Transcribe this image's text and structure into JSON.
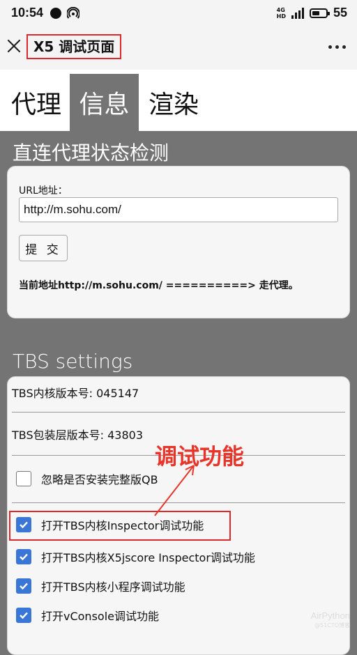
{
  "status_bar": {
    "time": "10:54",
    "network": "4G\nHD",
    "battery": "55",
    "battery_level": 0.55
  },
  "titlebar": {
    "title": "X5 调试页面",
    "close_icon": "close-icon",
    "more_icon": "more-icon"
  },
  "tabs": [
    {
      "label": "代理",
      "active": false
    },
    {
      "label": "信息",
      "active": true
    },
    {
      "label": "渲染",
      "active": false
    }
  ],
  "proxy": {
    "section_title": "直连代理状态检测",
    "url_label": "URL地址：",
    "url_value": "http://m.sohu.com/",
    "submit_label": "提 交",
    "status_text": "当前地址http://m.sohu.com/ ==========> 走代理。"
  },
  "tbs": {
    "section_title": "TBS settings",
    "kernel_version": "TBS内核版本号: 045147",
    "wrapper_version": "TBS包装层版本号: 43803",
    "options": [
      {
        "label": "忽略是否安装完整版QB",
        "checked": false
      },
      {
        "label": "打开TBS内核Inspector调试功能",
        "checked": true
      },
      {
        "label": "打开TBS内核X5jscore Inspector调试功能",
        "checked": true
      },
      {
        "label": "打开TBS内核小程序调试功能",
        "checked": true
      },
      {
        "label": "打开vConsole调试功能",
        "checked": true
      }
    ]
  },
  "annotation": {
    "label": "调试功能",
    "color": "#e8352a"
  },
  "watermark": {
    "name": "AirPython",
    "credit": "@51CTO博客"
  },
  "colors": {
    "panel_bg": "#747474",
    "active_tab_bg": "#747474",
    "checkbox_on": "#3a76d6",
    "highlight": "#e0282a"
  }
}
